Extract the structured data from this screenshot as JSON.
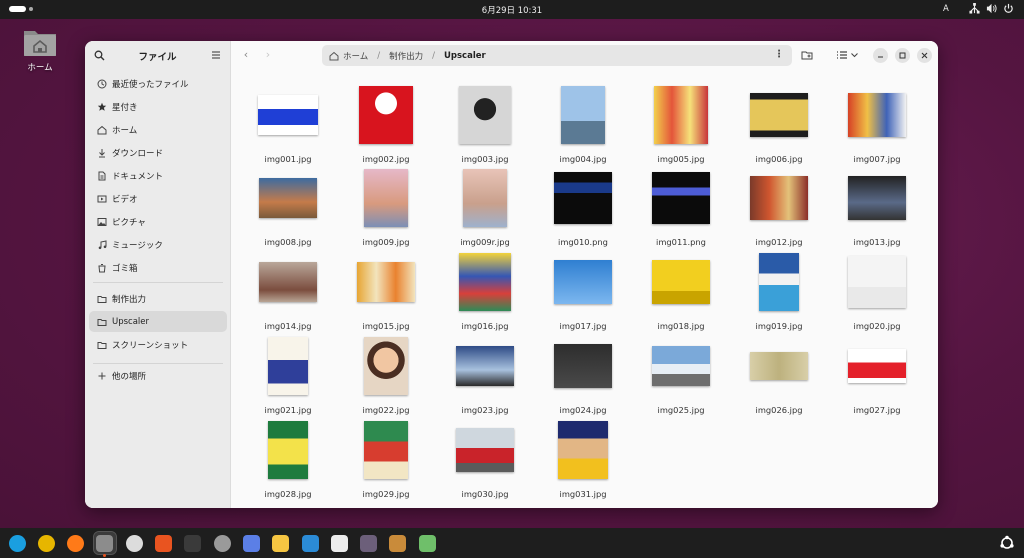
{
  "topbar": {
    "clock": "6月29日 10:31",
    "input_method": "A"
  },
  "desktop": {
    "home_icon_label": "ホーム"
  },
  "window": {
    "sidebar_title": "ファイル",
    "sidebar_items": [
      {
        "label": "最近使ったファイル",
        "icon": "clock-icon"
      },
      {
        "label": "星付き",
        "icon": "star-icon"
      },
      {
        "label": "ホーム",
        "icon": "home-icon"
      },
      {
        "label": "ダウンロード",
        "icon": "download-icon"
      },
      {
        "label": "ドキュメント",
        "icon": "document-icon"
      },
      {
        "label": "ビデオ",
        "icon": "video-icon"
      },
      {
        "label": "ピクチャ",
        "icon": "picture-icon"
      },
      {
        "label": "ミュージック",
        "icon": "music-icon"
      },
      {
        "label": "ゴミ箱",
        "icon": "trash-icon"
      }
    ],
    "bookmarks": [
      {
        "label": "制作出力",
        "icon": "folder-icon"
      },
      {
        "label": "Upscaler",
        "icon": "folder-icon",
        "selected": true
      },
      {
        "label": "スクリーンショット",
        "icon": "folder-icon"
      }
    ],
    "other_locations": "他の場所",
    "path": {
      "home": "ホーム",
      "segment": "制作出力",
      "current": "Upscaler"
    },
    "files": [
      "img001.jpg",
      "img002.jpg",
      "img003.jpg",
      "img004.jpg",
      "img005.jpg",
      "img006.jpg",
      "img007.jpg",
      "img008.jpg",
      "img009.jpg",
      "img009r.jpg",
      "img010.png",
      "img011.png",
      "img012.jpg",
      "img013.jpg",
      "img014.jpg",
      "img015.jpg",
      "img016.jpg",
      "img017.jpg",
      "img018.jpg",
      "img019.jpg",
      "img020.jpg",
      "img021.jpg",
      "img022.jpg",
      "img023.jpg",
      "img024.jpg",
      "img025.jpg",
      "img026.jpg",
      "img027.jpg",
      "img028.jpg",
      "img029.jpg",
      "img030.jpg",
      "img031.jpg"
    ]
  },
  "dock": {
    "apps": [
      {
        "name": "edge-icon",
        "color": "#1a9fe0"
      },
      {
        "name": "chrome-icon",
        "color": "#e7b600"
      },
      {
        "name": "firefox-icon",
        "color": "#ff7a18"
      },
      {
        "name": "files-icon",
        "color": "#8c8c8c",
        "active": true
      },
      {
        "name": "chat-icon",
        "color": "#dcdcdc"
      },
      {
        "name": "appcenter-icon",
        "color": "#e95420"
      },
      {
        "name": "terminal-icon",
        "color": "#3a3a3a"
      },
      {
        "name": "settings-icon",
        "color": "#9a9a9a"
      },
      {
        "name": "screenshot-icon",
        "color": "#5b7fe6"
      },
      {
        "name": "notes-icon",
        "color": "#f5c542"
      },
      {
        "name": "vscode-icon",
        "color": "#2b8bd6"
      },
      {
        "name": "inkscape-icon",
        "color": "#ededed"
      },
      {
        "name": "gimp-icon",
        "color": "#6c5f7a"
      },
      {
        "name": "library-icon",
        "color": "#c98b3a"
      },
      {
        "name": "trash-dock-icon",
        "color": "#6fbf6a"
      }
    ],
    "apps_grid": "show-apps-icon"
  }
}
